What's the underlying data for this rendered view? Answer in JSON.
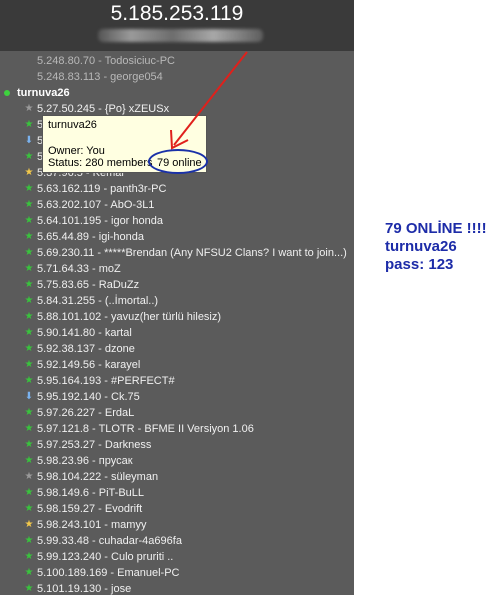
{
  "header": {
    "ip": "5.185.253.119"
  },
  "offline_rows": [
    "5.248.80.70 - Todosiciuc-PC",
    "5.248.83.113 - george054"
  ],
  "group": {
    "name": "turnuva26"
  },
  "members": [
    {
      "text": "5.27.50.245 - {Po} xZEUSx",
      "icon": "grey"
    },
    {
      "text": "5",
      "icon": "green"
    },
    {
      "text": "5",
      "icon": "arrow"
    },
    {
      "text": "5",
      "icon": "green"
    },
    {
      "text": "5.37.96.5 - Kemal",
      "icon": "gold"
    },
    {
      "text": "5.63.162.119 - panth3r-PC",
      "icon": "green"
    },
    {
      "text": "5.63.202.107 - AbO-3L1",
      "icon": "green"
    },
    {
      "text": "5.64.101.195 - igor honda",
      "icon": "green"
    },
    {
      "text": "5.65.44.89 - igi-honda",
      "icon": "green"
    },
    {
      "text": "5.69.230.11 - *****Brendan (Any NFSU2 Clans? I want to join...)",
      "icon": "green"
    },
    {
      "text": "5.71.64.33 - moZ",
      "icon": "green"
    },
    {
      "text": "5.75.83.65 - RaDuZz",
      "icon": "green"
    },
    {
      "text": "5.84.31.255 - (..İmortal..)",
      "icon": "green"
    },
    {
      "text": "5.88.101.102 - yavuz(her türlü hilesiz)",
      "icon": "green"
    },
    {
      "text": "5.90.141.80 - kartal",
      "icon": "green"
    },
    {
      "text": "5.92.38.137 - dzone",
      "icon": "green"
    },
    {
      "text": "5.92.149.56 - karayel",
      "icon": "green"
    },
    {
      "text": "5.95.164.193 - #PERFECT#",
      "icon": "green"
    },
    {
      "text": "5.95.192.140 - Ck.75",
      "icon": "arrow"
    },
    {
      "text": "5.97.26.227 - ErdaL",
      "icon": "green"
    },
    {
      "text": "5.97.121.8 - TLOTR - BFME II Versiyon 1.06",
      "icon": "green"
    },
    {
      "text": "5.97.253.27 - Darkness",
      "icon": "green"
    },
    {
      "text": "5.98.23.96 - прусак",
      "icon": "green"
    },
    {
      "text": "5.98.104.222 - süleyman",
      "icon": "grey"
    },
    {
      "text": "5.98.149.6 - PiT-BuLL",
      "icon": "green"
    },
    {
      "text": "5.98.159.27 - Evodrift",
      "icon": "green"
    },
    {
      "text": "5.98.243.101 - mamyy",
      "icon": "gold"
    },
    {
      "text": "5.99.33.48 - cuhadar-4a696fa",
      "icon": "green"
    },
    {
      "text": "5.99.123.240 - Culo pruriti ..",
      "icon": "green"
    },
    {
      "text": "5.100.189.169 - Emanuel-PC",
      "icon": "green"
    },
    {
      "text": "5.101.19.130 - jose",
      "icon": "green"
    }
  ],
  "tooltip": {
    "name": "turnuva26",
    "owner": "Owner: You",
    "status": "Status: 280 members",
    "online": "79 online"
  },
  "annotation": {
    "line1": "79 ONLİNE !!!!",
    "line2": "turnuva26",
    "line3": "pass: 123",
    "color": "#1d2ca8",
    "arrow_color": "#e0201b"
  }
}
